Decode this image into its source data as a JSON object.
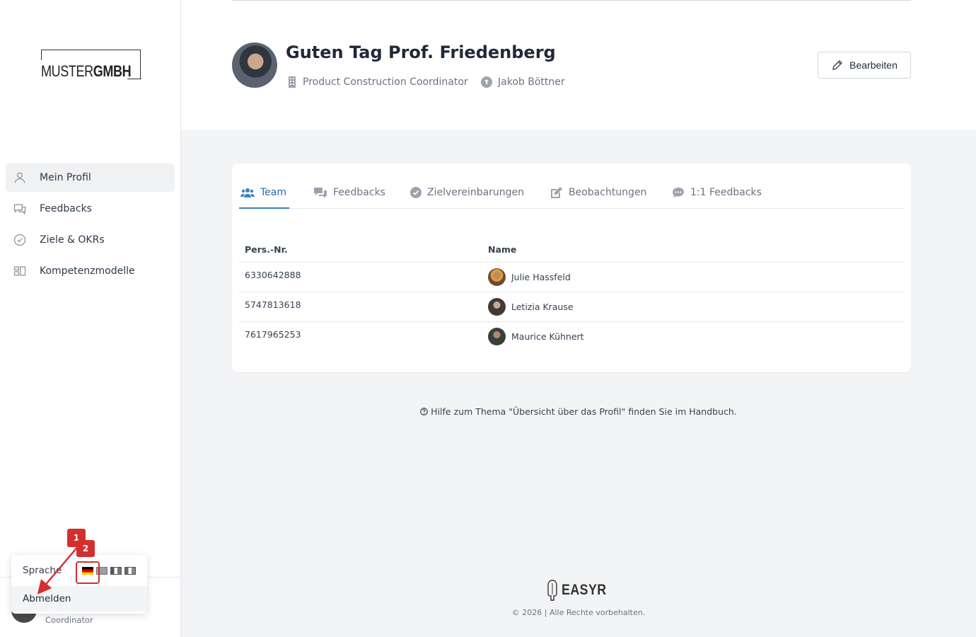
{
  "sidebar": {
    "logo": {
      "part1": "MUSTER",
      "part2": "GMBH"
    },
    "items": [
      {
        "label": "Mein Profil",
        "icon": "user-icon",
        "active": true
      },
      {
        "label": "Feedbacks",
        "icon": "chat-bubbles-icon",
        "active": false
      },
      {
        "label": "Ziele & OKRs",
        "icon": "check-circle-icon",
        "active": false
      },
      {
        "label": "Kompetenzmodelle",
        "icon": "modules-icon",
        "active": false
      }
    ],
    "user_role": "Coordinator"
  },
  "dropdown": {
    "language_label": "Sprache",
    "languages": [
      "de",
      "en",
      "fr",
      "it"
    ],
    "logout_label": "Abmelden"
  },
  "annotations": {
    "badge1": "1",
    "badge2": "2",
    "color": "#d32f2f"
  },
  "header": {
    "greeting": "Guten Tag Prof. Friedenberg",
    "job_title": "Product Construction Coordinator",
    "supervisor": "Jakob Böttner",
    "edit_label": "Bearbeiten"
  },
  "tabs": [
    {
      "label": "Team",
      "icon": "team-icon",
      "active": true
    },
    {
      "label": "Feedbacks",
      "icon": "comments-icon",
      "active": false
    },
    {
      "label": "Zielvereinbarungen",
      "icon": "check-circle-icon",
      "active": false
    },
    {
      "label": "Beobachtungen",
      "icon": "edit-icon",
      "active": false
    },
    {
      "label": "1:1 Feedbacks",
      "icon": "comment-dots-icon",
      "active": false
    }
  ],
  "table": {
    "columns": [
      "Pers.-Nr.",
      "Name"
    ],
    "rows": [
      {
        "id": "6330642888",
        "name": "Julie Hassfeld"
      },
      {
        "id": "5747813618",
        "name": "Letizia Krause"
      },
      {
        "id": "7617965253",
        "name": "Maurice Kühnert"
      }
    ]
  },
  "help_text": "Hilfe zum Thema \"Übersicht über das Profil\" finden Sie im Handbuch.",
  "footer": {
    "brand": "EASYR",
    "copyright": "© 2026 | Alle Rechte vorbehalten."
  },
  "colors": {
    "accent": "#3b82c4",
    "annotation": "#d32f2f"
  }
}
